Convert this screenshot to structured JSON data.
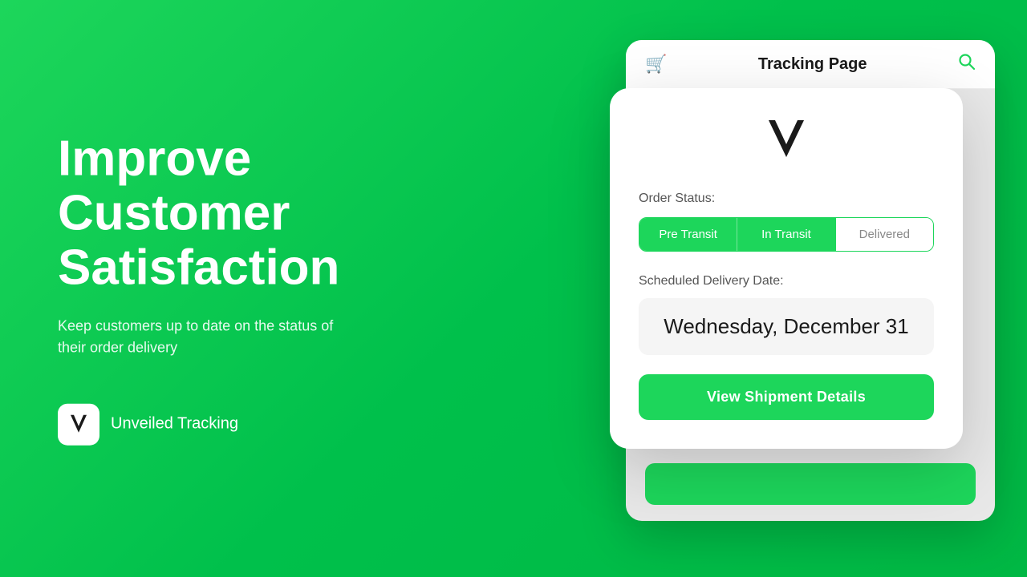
{
  "page": {
    "background_color": "#1dd65b"
  },
  "left": {
    "headline": "Improve Customer Satisfaction",
    "subtitle": "Keep customers up to date on the status of their order delivery",
    "brand_name": "Unveiled Tracking"
  },
  "browser": {
    "title": "Tracking Page",
    "cart_icon": "🛒",
    "search_icon": "🔍"
  },
  "modal": {
    "order_status_label": "Order Status:",
    "tabs": [
      {
        "label": "Pre Transit",
        "state": "active"
      },
      {
        "label": "In Transit",
        "state": "active-selected"
      },
      {
        "label": "Delivered",
        "state": "inactive"
      }
    ],
    "delivery_label": "Scheduled Delivery Date:",
    "delivery_date": "Wednesday, December 31",
    "view_button": "View Shipment Details"
  }
}
